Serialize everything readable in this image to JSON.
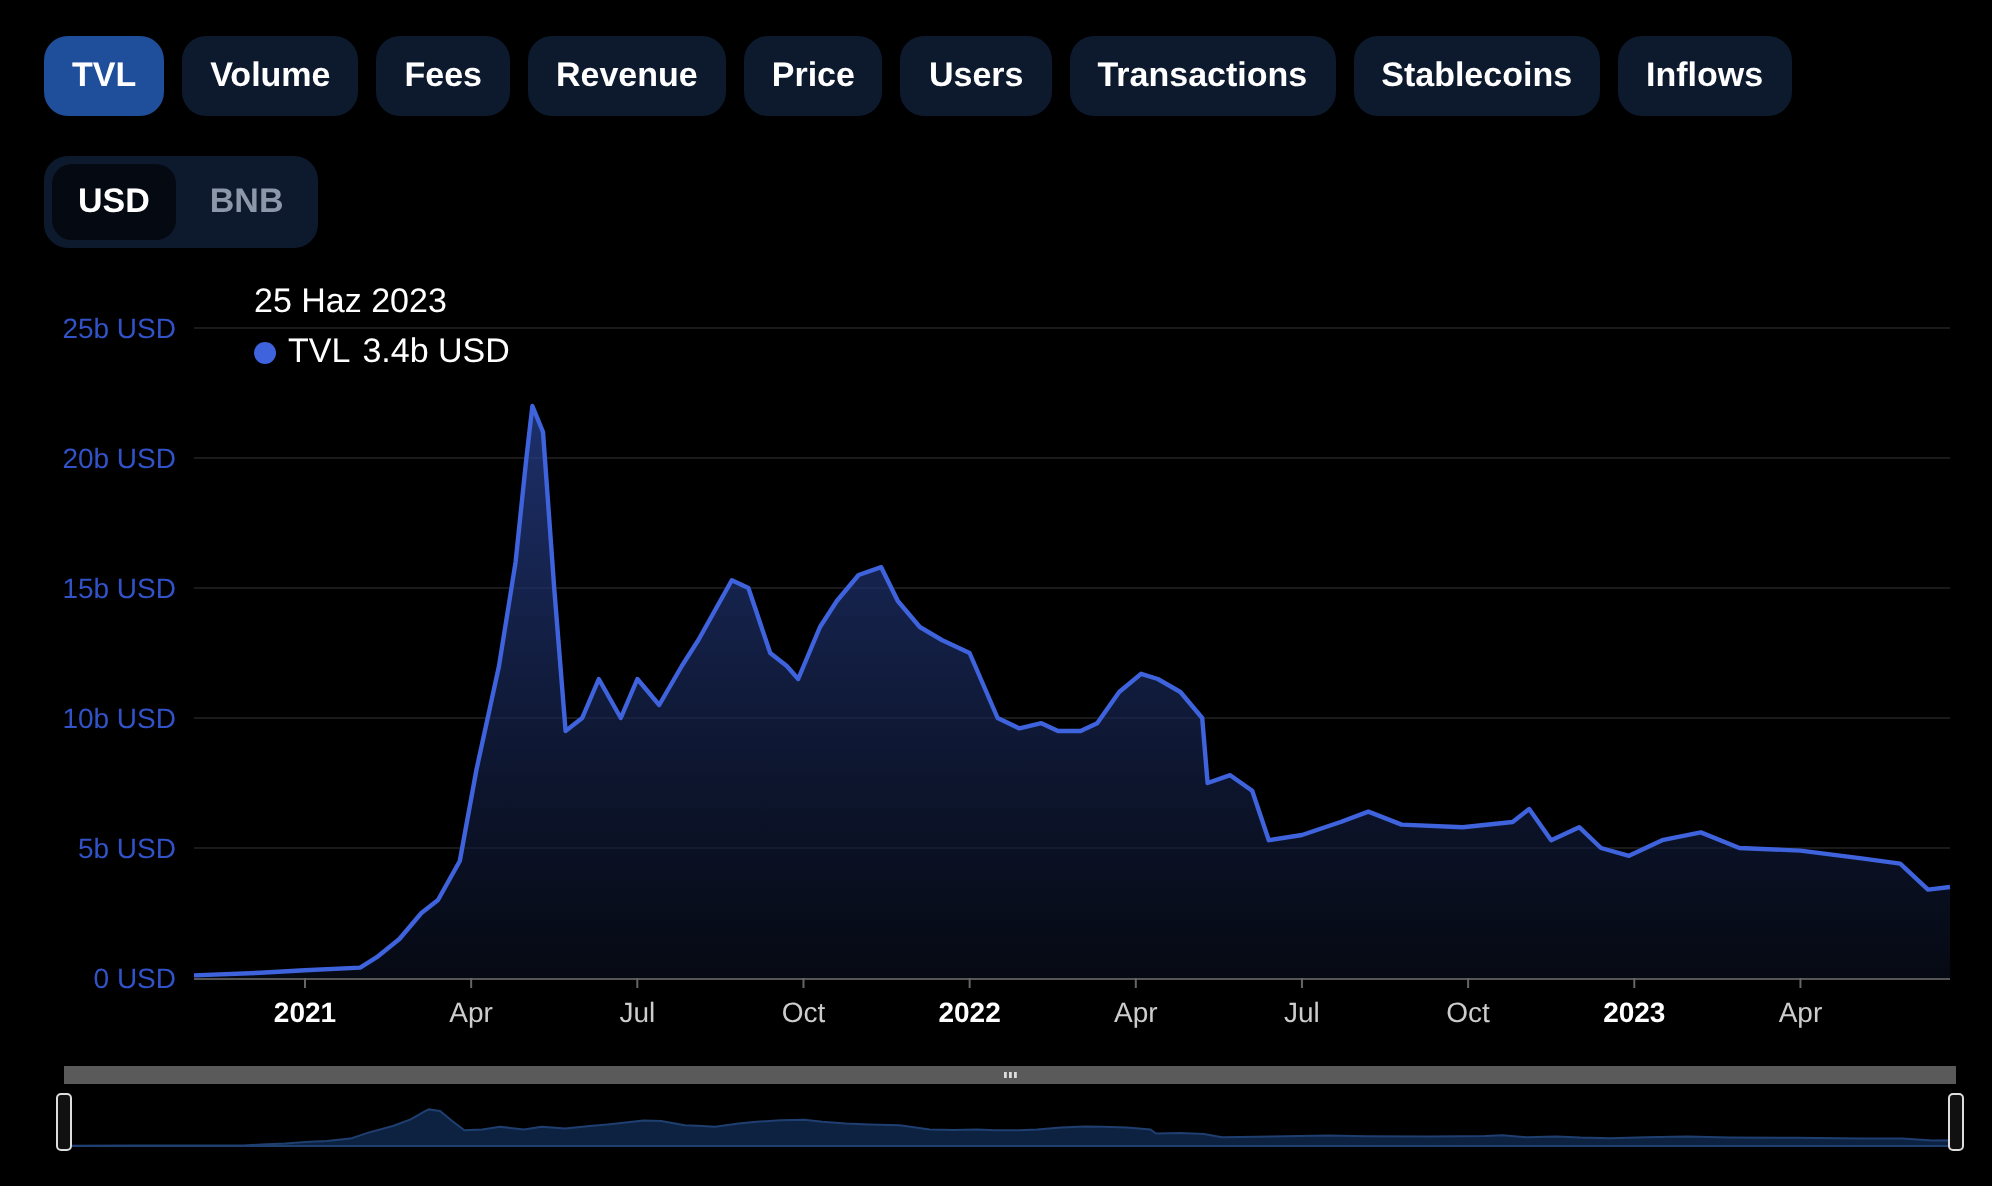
{
  "metric_tabs": [
    {
      "label": "TVL",
      "selected": true
    },
    {
      "label": "Volume",
      "selected": false
    },
    {
      "label": "Fees",
      "selected": false
    },
    {
      "label": "Revenue",
      "selected": false
    },
    {
      "label": "Price",
      "selected": false
    },
    {
      "label": "Users",
      "selected": false
    },
    {
      "label": "Transactions",
      "selected": false
    },
    {
      "label": "Stablecoins",
      "selected": false
    },
    {
      "label": "Inflows",
      "selected": false
    }
  ],
  "currency_toggle": [
    {
      "label": "USD",
      "selected": true
    },
    {
      "label": "BNB",
      "selected": false
    }
  ],
  "chart": {
    "tooltip": {
      "date": "25 Haz 2023",
      "value": "3.4b USD"
    },
    "chart_data": {
      "type": "area",
      "grid": true,
      "ylim": [
        0,
        25
      ],
      "xlim": [
        2020.833,
        2023.475
      ],
      "yticks": [
        {
          "value": 0,
          "label": "0 USD"
        },
        {
          "value": 5,
          "label": "5b USD"
        },
        {
          "value": 10,
          "label": "10b USD"
        },
        {
          "value": 15,
          "label": "15b USD"
        },
        {
          "value": 20,
          "label": "20b USD"
        },
        {
          "value": 25,
          "label": "25b USD"
        }
      ],
      "xticks": [
        {
          "value": 2021,
          "label": "2021"
        },
        {
          "value": 2021.25,
          "label": "Apr"
        },
        {
          "value": 2021.5,
          "label": "Jul"
        },
        {
          "value": 2021.75,
          "label": "Oct"
        },
        {
          "value": 2022,
          "label": "2022"
        },
        {
          "value": 2022.25,
          "label": "Apr"
        },
        {
          "value": 2022.5,
          "label": "Jul"
        },
        {
          "value": 2022.75,
          "label": "Oct"
        },
        {
          "value": 2023,
          "label": "2023"
        },
        {
          "value": 2023.25,
          "label": "Apr"
        }
      ],
      "x": [
        2020.833,
        2020.933,
        2021.0,
        2021.083,
        2021.108,
        2021.142,
        2021.175,
        2021.2,
        2021.233,
        2021.258,
        2021.292,
        2021.317,
        2021.333,
        2021.342,
        2021.358,
        2021.375,
        2021.392,
        2021.417,
        2021.442,
        2021.475,
        2021.5,
        2021.533,
        2021.567,
        2021.592,
        2021.642,
        2021.667,
        2021.7,
        2021.725,
        2021.742,
        2021.775,
        2021.8,
        2021.833,
        2021.867,
        2021.892,
        2021.925,
        2021.958,
        2022.0,
        2022.042,
        2022.075,
        2022.108,
        2022.133,
        2022.167,
        2022.192,
        2022.225,
        2022.258,
        2022.283,
        2022.317,
        2022.35,
        2022.358,
        2022.392,
        2022.425,
        2022.45,
        2022.5,
        2022.558,
        2022.6,
        2022.65,
        2022.742,
        2022.817,
        2022.842,
        2022.875,
        2022.917,
        2022.95,
        2022.992,
        2023.042,
        2023.1,
        2023.158,
        2023.25,
        2023.342,
        2023.4,
        2023.442,
        2023.475
      ],
      "series": [
        {
          "name": "TVL",
          "color": "#3e63dd",
          "values": [
            0.1,
            0.2,
            0.3,
            0.4,
            0.8,
            1.5,
            2.5,
            3.0,
            4.5,
            8,
            12,
            16,
            20,
            22,
            21,
            15,
            9.5,
            10,
            11.5,
            10,
            11.5,
            10.5,
            12,
            13,
            15.3,
            15,
            12.5,
            12,
            11.5,
            13.5,
            14.5,
            15.5,
            15.8,
            14.5,
            13.5,
            13,
            12.5,
            10,
            9.6,
            9.8,
            9.5,
            9.5,
            9.8,
            11,
            11.7,
            11.5,
            11,
            10,
            7.5,
            7.8,
            7.2,
            5.3,
            5.5,
            6,
            6.4,
            5.9,
            5.8,
            6,
            6.5,
            5.3,
            5.8,
            5,
            4.7,
            5.3,
            5.6,
            5,
            4.9,
            4.6,
            4.4,
            3.4,
            3.5
          ]
        }
      ]
    }
  }
}
